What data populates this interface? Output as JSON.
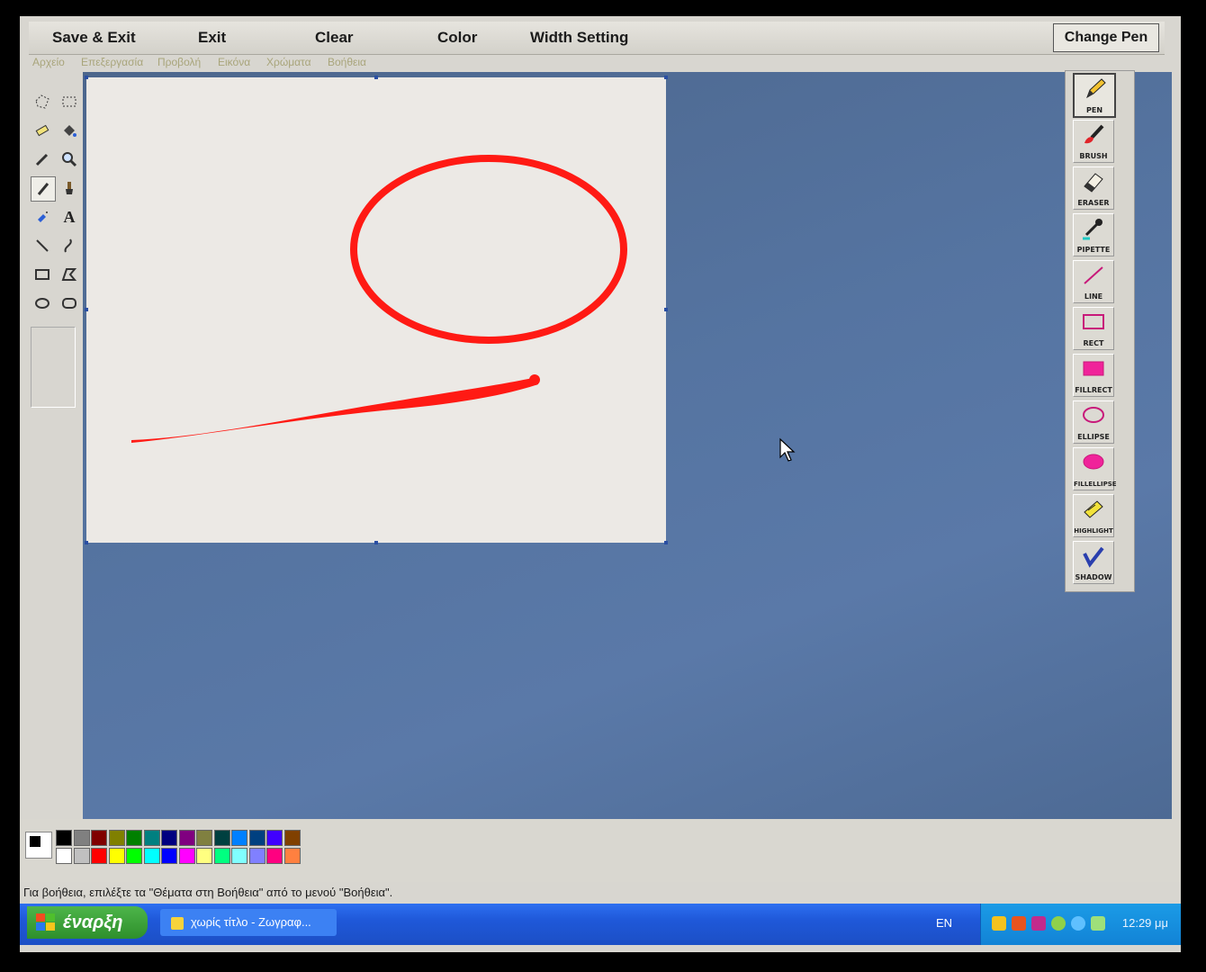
{
  "topbar": {
    "save_exit": "Save & Exit",
    "exit": "Exit",
    "clear": "Clear",
    "color": "Color",
    "width_setting": "Width Setting",
    "change_pen": "Change Pen"
  },
  "menu": {
    "file": "Αρχείο",
    "edit": "Επεξεργασία",
    "view": "Προβολή",
    "image": "Εικόνα",
    "colors": "Χρώματα",
    "help": "Βοήθεια"
  },
  "pen_tools": [
    {
      "label": "PEN",
      "icon": "pen-icon"
    },
    {
      "label": "BRUSH",
      "icon": "brush-icon"
    },
    {
      "label": "ERASER",
      "icon": "eraser-icon"
    },
    {
      "label": "PIPETTE",
      "icon": "pipette-icon"
    },
    {
      "label": "LINE",
      "icon": "line-icon"
    },
    {
      "label": "RECT",
      "icon": "rect-icon"
    },
    {
      "label": "FILLRECT",
      "icon": "fillrect-icon"
    },
    {
      "label": "ELLIPSE",
      "icon": "ellipse-icon"
    },
    {
      "label": "FILLELLIPSE",
      "icon": "fillellipse-icon"
    },
    {
      "label": "HIGHLIGHT",
      "icon": "highlight-icon"
    },
    {
      "label": "SHADOW",
      "icon": "shadow-icon"
    }
  ],
  "colors": {
    "stroke": "#ff1a14",
    "palette_top": [
      "#000000",
      "#808080",
      "#800000",
      "#808000",
      "#008000",
      "#008080",
      "#000080",
      "#800080",
      "#808040",
      "#004040",
      "#0080ff",
      "#004080",
      "#4000ff",
      "#804000"
    ],
    "palette_bottom": [
      "#ffffff",
      "#c0c0c0",
      "#ff0000",
      "#ffff00",
      "#00ff00",
      "#00ffff",
      "#0000ff",
      "#ff00ff",
      "#ffff80",
      "#00ff80",
      "#80ffff",
      "#8080ff",
      "#ff0080",
      "#ff8040"
    ]
  },
  "status": {
    "help_text": "Για βοήθεια, επιλέξτε τα \"Θέματα στη Βοήθεια\" από το μενού \"Βοήθεια\"."
  },
  "taskbar": {
    "start_label": "έναρξη",
    "window_label": "χωρίς τίτλο - Ζωγραφ...",
    "language": "EN",
    "clock": "12:29 μμ"
  }
}
